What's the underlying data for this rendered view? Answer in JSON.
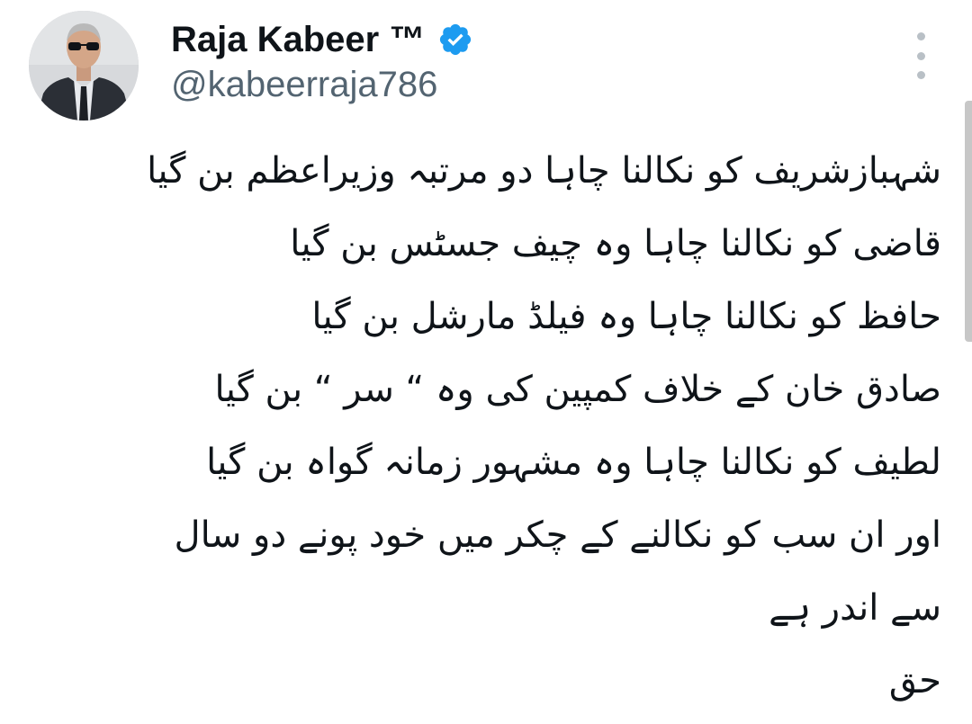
{
  "author": {
    "display_name": "Raja Kabeer ™",
    "handle": "@kabeerraja786",
    "verified": true,
    "avatar_icon": "profile-photo"
  },
  "tweet": {
    "lines": [
      "شہبازشریف کو نکالنا چاہا دو مرتبہ وزیراعظم بن گیا",
      "قاضی کو نکالنا چاہا وہ چیف جسٹس بن گیا",
      "حافظ کو نکالنا چاہا وہ فیلڈ مارشل بن گیا",
      "صادق خان کے خلاف کمپین کی وہ “ سر “ بن گیا",
      "لطیف کو نکالنا چاہا وہ مشہور زمانہ گواہ بن گیا",
      "اور ان سب کو نکالنے کے چکر میں خود پونے دو سال",
      "سے اندر ہے",
      "حق"
    ]
  },
  "colors": {
    "text_primary": "#0f1419",
    "text_secondary": "#536471",
    "verified_badge": "#1d9bf0",
    "more_dots": "#b9c0c6"
  },
  "icons": {
    "verified": "verified-badge-icon",
    "more": "more-vertical-icon"
  }
}
